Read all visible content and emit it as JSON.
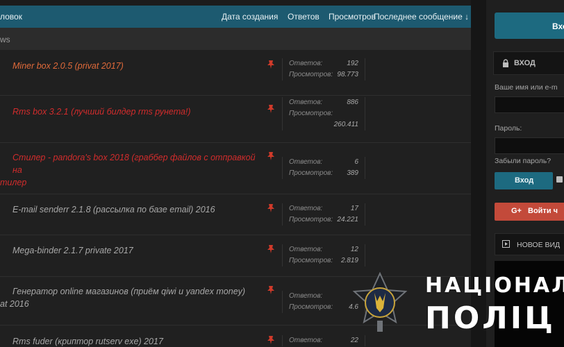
{
  "list": {
    "columns": {
      "title": "ловок",
      "created": "Дата создания",
      "replies": "Ответов",
      "views": "Просмотров",
      "last": "Последнее сообщение ↓"
    },
    "subheader": "ws",
    "threads": [
      {
        "title": "Miner box 2.0.5 (privat 2017)",
        "replies_label": "Ответов:",
        "replies": "192",
        "views_label": "Просмотров:",
        "views": "98.773"
      },
      {
        "title": "Rms box 3.2.1 (лучший билдер rms рунета!)",
        "replies_label": "Ответов:",
        "replies": "886",
        "views_label": "Просмотров:",
        "views": "260.411"
      },
      {
        "title": "Стилер - pandora's box 2018 (граббер файлов с отправкой на",
        "title2": "тилер",
        "replies_label": "Ответов:",
        "replies": "6",
        "views_label": "Просмотров:",
        "views": "389"
      },
      {
        "title": "E-mail senderr 2.1.8 (рассылка по базе email) 2016",
        "replies_label": "Ответов:",
        "replies": "17",
        "views_label": "Просмотров:",
        "views": "24.221"
      },
      {
        "title": "Mega-binder 2.1.7 private 2017",
        "replies_label": "Ответов:",
        "replies": "12",
        "views_label": "Просмотров:",
        "views": "2.819"
      },
      {
        "title": "Генератор online магазинов (приём qiwi и yandex money)",
        "title2": "at 2016",
        "replies_label": "Ответов:",
        "views_label": "Просмотров:",
        "views": "4.6"
      },
      {
        "title": "Rms fuder (криптор rutserv exe) 2017",
        "replies_label": "Ответов:",
        "replies": "22"
      }
    ]
  },
  "sidebar": {
    "top_button": "Вхо",
    "login_header": "ВХОД",
    "username_label": "Ваше имя или e-m",
    "password_label": "Пароль:",
    "forgot_label": "Забыли пароль?",
    "login_button": "Вход",
    "google_icon": "G+",
    "google_button": "Войти ч",
    "video_header": "НОВОЕ ВИД"
  },
  "watermark": {
    "line1": "НАЦІОНАЛ",
    "line2": "ПОЛІЦ"
  },
  "colors": {
    "accent": "#1d6a80",
    "header": "#1d5a70",
    "pinned_orange": "#e06a3a",
    "pinned_red": "#d22c2c",
    "google": "#c34a3a"
  }
}
